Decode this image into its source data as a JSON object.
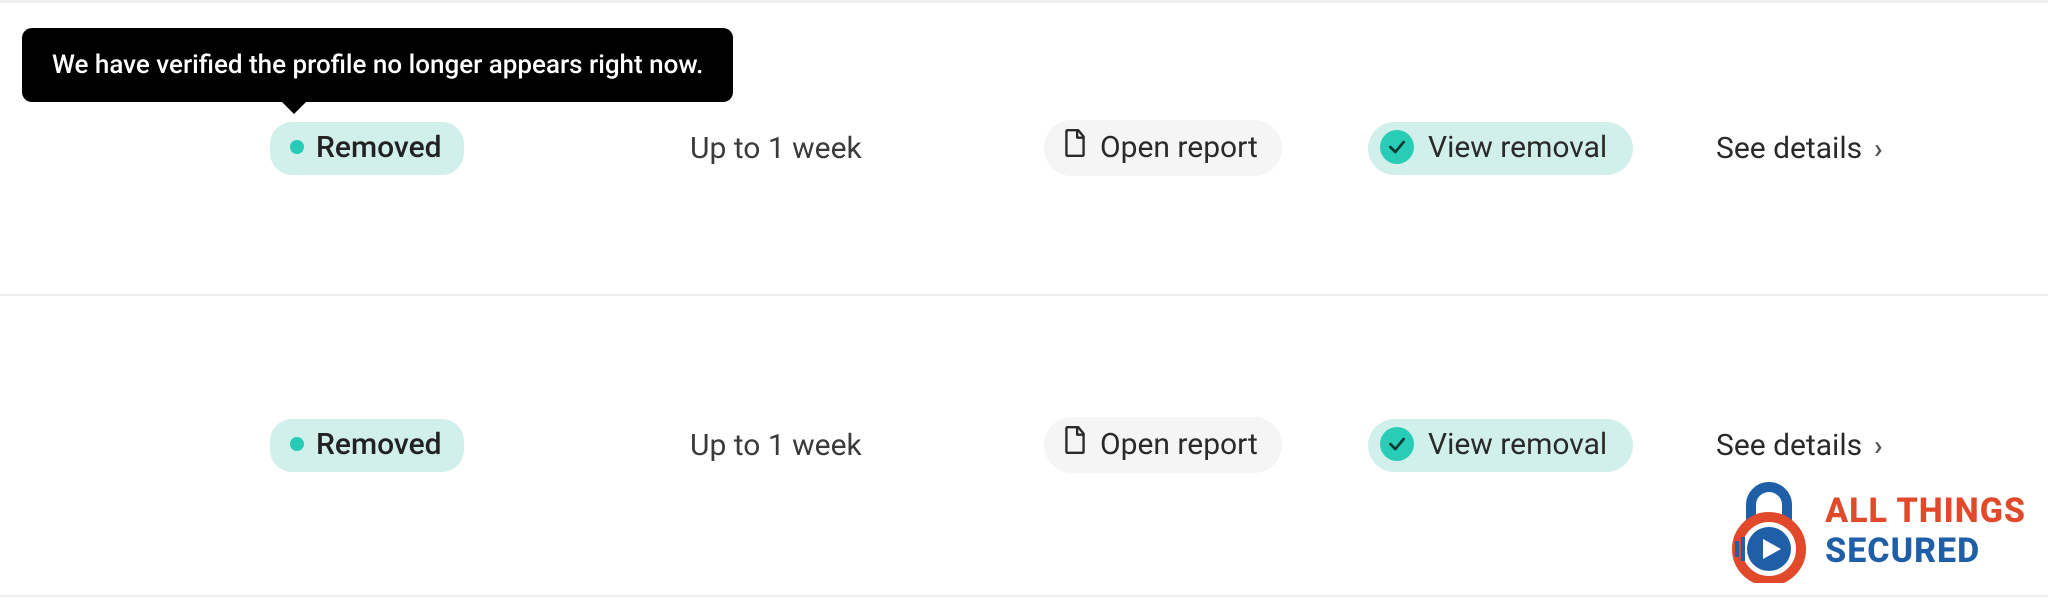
{
  "tooltip": {
    "text": "We have verified the profile no longer appears right now."
  },
  "rows": [
    {
      "status_label": "Removed",
      "duration": "Up to 1 week",
      "open_report_label": "Open report",
      "view_removal_label": "View removal",
      "see_details_label": "See details"
    },
    {
      "status_label": "Removed",
      "duration": "Up to 1 week",
      "open_report_label": "Open report",
      "view_removal_label": "View removal",
      "see_details_label": "See details"
    }
  ],
  "colors": {
    "accent_mint_bg": "#d2f0eb",
    "accent_mint_solid": "#29cdb7",
    "tooltip_bg": "#000000",
    "brand_orange": "#e04a2b",
    "brand_blue": "#1f5fa8"
  },
  "logo": {
    "line1": "ALL THINGS",
    "line2": "SECURED"
  }
}
